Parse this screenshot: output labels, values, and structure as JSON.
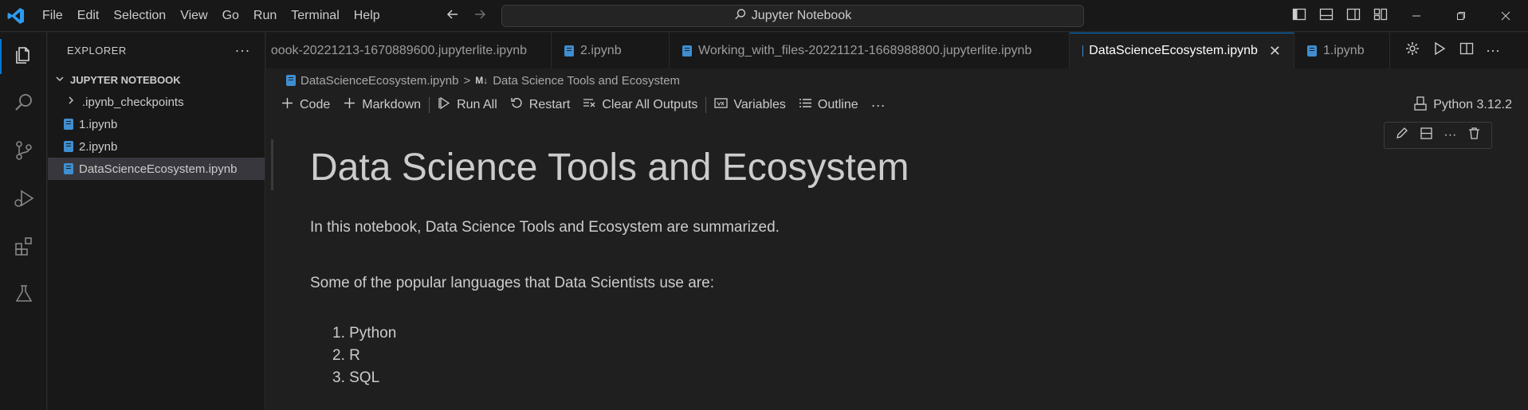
{
  "window": {
    "menu": [
      "File",
      "Edit",
      "Selection",
      "View",
      "Go",
      "Run",
      "Terminal",
      "Help"
    ],
    "search_text": "Jupyter Notebook"
  },
  "sidebar": {
    "title": "EXPLORER",
    "more": "···",
    "section": "JUPYTER NOTEBOOK",
    "items": [
      {
        "label": ".ipynb_checkpoints",
        "type": "folder"
      },
      {
        "label": "1.ipynb",
        "type": "notebook"
      },
      {
        "label": "2.ipynb",
        "type": "notebook"
      },
      {
        "label": "DataScienceEcosystem.ipynb",
        "type": "notebook",
        "selected": true
      }
    ]
  },
  "tabs": [
    {
      "label": "oook-20221213-1670889600.jupyterlite.ipynb"
    },
    {
      "label": "2.ipynb"
    },
    {
      "label": "Working_with_files-20221121-1668988800.jupyterlite.ipynb"
    },
    {
      "label": "DataScienceEcosystem.ipynb",
      "active": true,
      "close": "✕"
    },
    {
      "label": "1.ipynb"
    }
  ],
  "breadcrumb": {
    "file": "DataScienceEcosystem.ipynb",
    "sep": ">",
    "md_badge": "M↓",
    "section": "Data Science Tools and Ecosystem"
  },
  "toolbar": {
    "code": "Code",
    "markdown": "Markdown",
    "run_all": "Run All",
    "restart": "Restart",
    "clear_outputs": "Clear All Outputs",
    "variables": "Variables",
    "outline": "Outline",
    "more": "···",
    "kernel": "Python 3.12.2"
  },
  "notebook": {
    "heading": "Data Science Tools and Ecosystem",
    "intro": "In this notebook, Data Science Tools and Ecosystem are summarized.",
    "languages_intro": "Some of the popular languages that Data Scientists use are:",
    "languages": [
      "1. Python",
      "2. R",
      "3. SQL"
    ]
  },
  "colors": {
    "accent": "#0078d4",
    "notebook_icon": "#3e8ed0"
  }
}
